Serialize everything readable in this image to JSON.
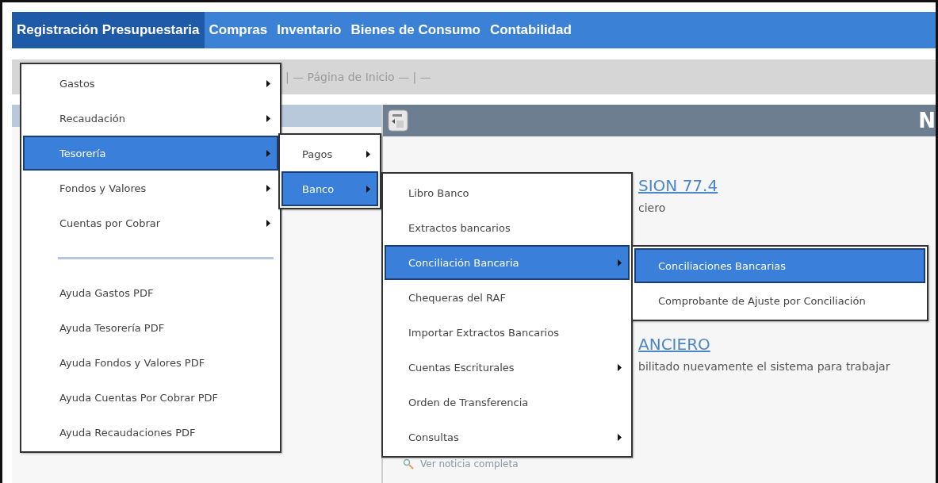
{
  "menubar": [
    {
      "label": "Registración Presupuestaria",
      "selected": true
    },
    {
      "label": "Compras",
      "selected": false
    },
    {
      "label": "Inventario",
      "selected": false
    },
    {
      "label": "Bienes de Consumo",
      "selected": false
    },
    {
      "label": "Contabilidad",
      "selected": false
    }
  ],
  "toolbar": {
    "breadcrumb": "| — Página de Inicio — | —"
  },
  "content": {
    "header_text": "N",
    "link_1": "SION 77.4",
    "text_1": "ciero",
    "link_2": "ANCIERO",
    "text_2": "bilitado nuevamente el sistema para trabajar",
    "more_link": "Ver noticia completa"
  },
  "menus": [
    {
      "items": [
        {
          "kind": "item",
          "label": "Gastos",
          "has_submenu": true,
          "selected": false
        },
        {
          "kind": "item",
          "label": "Recaudación",
          "has_submenu": true,
          "selected": false
        },
        {
          "kind": "item",
          "label": "Tesorería",
          "has_submenu": true,
          "selected": true
        },
        {
          "kind": "item",
          "label": "Fondos y Valores",
          "has_submenu": true,
          "selected": false
        },
        {
          "kind": "item",
          "label": "Cuentas por Cobrar",
          "has_submenu": true,
          "selected": false
        },
        {
          "kind": "separator"
        },
        {
          "kind": "item",
          "label": "Ayuda Gastos PDF",
          "has_submenu": false,
          "selected": false
        },
        {
          "kind": "item",
          "label": "Ayuda Tesorería PDF",
          "has_submenu": false,
          "selected": false
        },
        {
          "kind": "item",
          "label": "Ayuda Fondos y Valores PDF",
          "has_submenu": false,
          "selected": false
        },
        {
          "kind": "item",
          "label": "Ayuda Cuentas Por Cobrar PDF",
          "has_submenu": false,
          "selected": false
        },
        {
          "kind": "item",
          "label": "Ayuda Recaudaciones PDF",
          "has_submenu": false,
          "selected": false
        }
      ]
    },
    {
      "items": [
        {
          "kind": "item",
          "label": "Pagos",
          "has_submenu": true,
          "selected": false
        },
        {
          "kind": "item",
          "label": "Banco",
          "has_submenu": true,
          "selected": true
        }
      ]
    },
    {
      "items": [
        {
          "kind": "item",
          "label": "Libro Banco",
          "has_submenu": false,
          "selected": false
        },
        {
          "kind": "item",
          "label": "Extractos bancarios",
          "has_submenu": false,
          "selected": false
        },
        {
          "kind": "item",
          "label": "Conciliación Bancaria",
          "has_submenu": true,
          "selected": true
        },
        {
          "kind": "item",
          "label": "Chequeras del RAF",
          "has_submenu": false,
          "selected": false
        },
        {
          "kind": "item",
          "label": "Importar Extractos Bancarios",
          "has_submenu": false,
          "selected": false
        },
        {
          "kind": "item",
          "label": "Cuentas Escriturales",
          "has_submenu": true,
          "selected": false
        },
        {
          "kind": "item",
          "label": "Orden de Transferencia",
          "has_submenu": false,
          "selected": false
        },
        {
          "kind": "item",
          "label": "Consultas",
          "has_submenu": true,
          "selected": false
        }
      ]
    },
    {
      "items": [
        {
          "kind": "item",
          "label": "Conciliaciones Bancarias",
          "has_submenu": false,
          "selected": true
        },
        {
          "kind": "item",
          "label": "Comprobante de Ajuste por Conciliación",
          "has_submenu": false,
          "selected": false
        }
      ]
    }
  ]
}
